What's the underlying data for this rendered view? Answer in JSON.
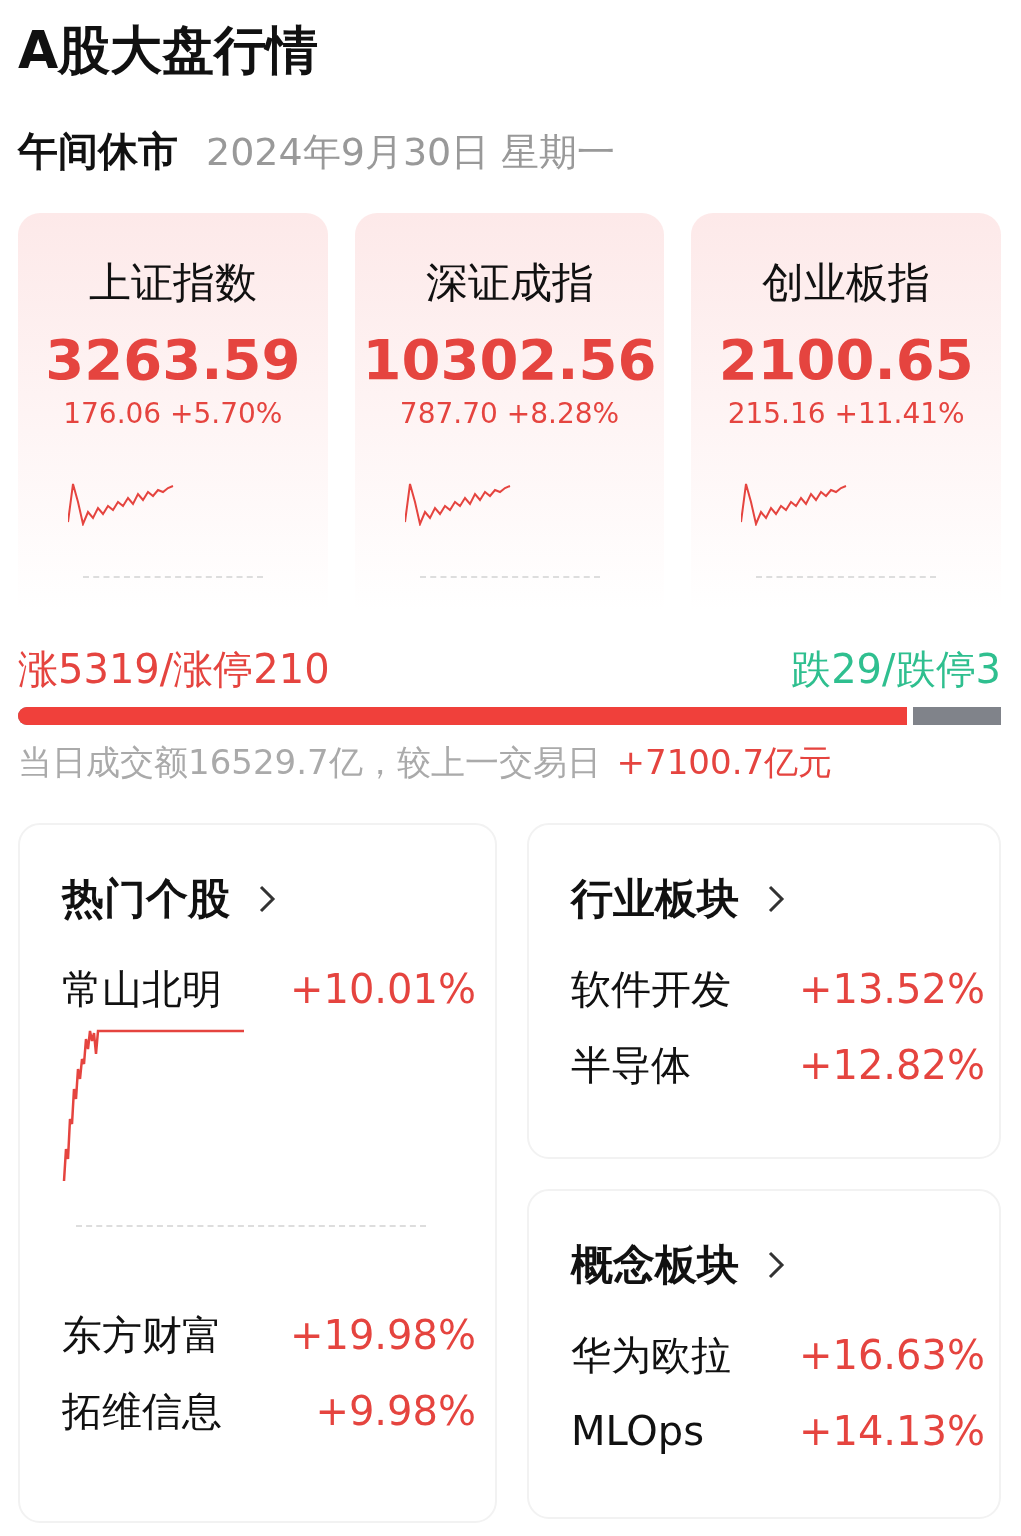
{
  "title": "A股大盘行情",
  "session": {
    "status": "午间休市",
    "date": "2024年9月30日 星期一"
  },
  "indices": [
    {
      "name": "上证指数",
      "value": "3263.59",
      "change": "176.06 +5.70%"
    },
    {
      "name": "深证成指",
      "value": "10302.56",
      "change": "787.70 +8.28%"
    },
    {
      "name": "创业板指",
      "value": "2100.65",
      "change": "215.16 +11.41%"
    }
  ],
  "breadth": {
    "up": "涨5319/涨停210",
    "down": "跌29/跌停3",
    "level": 0.91
  },
  "turnover": {
    "text": "当日成交额16529.7亿，较上一交易日",
    "delta": "+7100.7亿元"
  },
  "hot_stocks": {
    "title": "热门个股",
    "items": [
      {
        "name": "常山北明",
        "change": "+10.01%",
        "kind": "chart"
      },
      {
        "name": "东方财富",
        "change": "+19.98%",
        "kind": "plain"
      },
      {
        "name": "拓维信息",
        "change": "+9.98%",
        "kind": "plain"
      }
    ]
  },
  "industry": {
    "title": "行业板块",
    "items": [
      {
        "name": "软件开发",
        "change": "+13.52%"
      },
      {
        "name": "半导体",
        "change": "+12.82%"
      }
    ]
  },
  "concept": {
    "title": "概念板块",
    "items": [
      {
        "name": "华为欧拉",
        "change": "+16.63%"
      },
      {
        "name": "MLOps",
        "change": "+14.13%"
      }
    ]
  }
}
